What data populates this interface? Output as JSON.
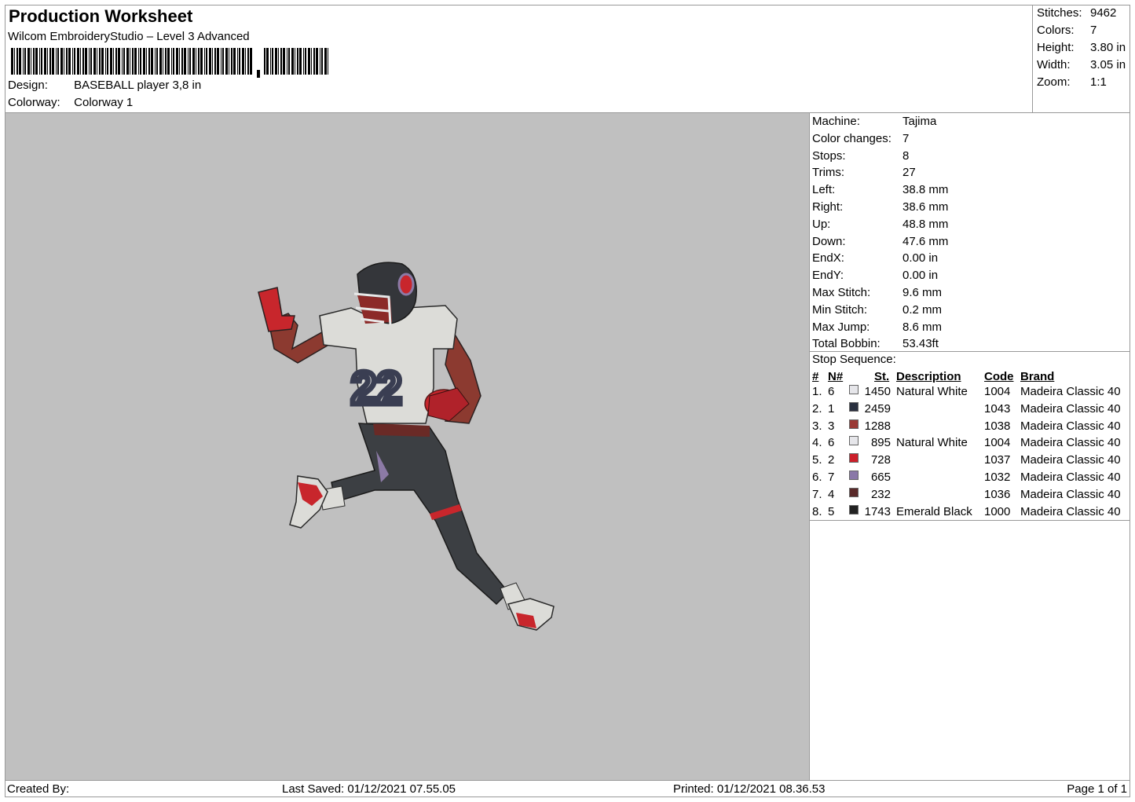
{
  "header": {
    "title": "Production Worksheet",
    "subtitle": "Wilcom EmbroideryStudio – Level 3 Advanced",
    "design_label": "Design:",
    "design_value": "BASEBALL player 3,8 in",
    "colorway_label": "Colorway:",
    "colorway_value": "Colorway 1"
  },
  "summary": [
    {
      "label": "Stitches:",
      "value": "9462"
    },
    {
      "label": "Colors:",
      "value": "7"
    },
    {
      "label": "Height:",
      "value": "3.80 in"
    },
    {
      "label": "Width:",
      "value": "3.05 in"
    },
    {
      "label": "Zoom:",
      "value": "1:1"
    }
  ],
  "machine": [
    {
      "label": "Machine:",
      "value": "Tajima"
    },
    {
      "label": "Color changes:",
      "value": "7"
    },
    {
      "label": "Stops:",
      "value": "8"
    },
    {
      "label": "Trims:",
      "value": "27"
    },
    {
      "label": "Left:",
      "value": "38.8 mm"
    },
    {
      "label": "Right:",
      "value": "38.6 mm"
    },
    {
      "label": "Up:",
      "value": "48.8 mm"
    },
    {
      "label": "Down:",
      "value": "47.6 mm"
    },
    {
      "label": "EndX:",
      "value": "0.00 in"
    },
    {
      "label": "EndY:",
      "value": "0.00 in"
    },
    {
      "label": "Max Stitch:",
      "value": "9.6 mm"
    },
    {
      "label": "Min Stitch:",
      "value": "0.2 mm"
    },
    {
      "label": "Max Jump:",
      "value": "8.6 mm"
    },
    {
      "label": "Total Bobbin:",
      "value": "53.43ft"
    }
  ],
  "stop_sequence": {
    "title": "Stop Sequence:",
    "headers": {
      "num": "#",
      "n": "N#",
      "st": "St.",
      "desc": "Description",
      "code": "Code",
      "brand": "Brand"
    },
    "rows": [
      {
        "num": "1.",
        "n": "6",
        "color": "#e6e6ea",
        "st": "1450",
        "desc": "Natural White",
        "code": "1004",
        "brand": "Madeira Classic 40"
      },
      {
        "num": "2.",
        "n": "1",
        "color": "#2a3040",
        "st": "2459",
        "desc": "",
        "code": "1043",
        "brand": "Madeira Classic 40"
      },
      {
        "num": "3.",
        "n": "3",
        "color": "#9a3a36",
        "st": "1288",
        "desc": "",
        "code": "1038",
        "brand": "Madeira Classic 40"
      },
      {
        "num": "4.",
        "n": "6",
        "color": "#e6e6ea",
        "st": "895",
        "desc": "Natural White",
        "code": "1004",
        "brand": "Madeira Classic 40"
      },
      {
        "num": "5.",
        "n": "2",
        "color": "#cc1f2a",
        "st": "728",
        "desc": "",
        "code": "1037",
        "brand": "Madeira Classic 40"
      },
      {
        "num": "6.",
        "n": "7",
        "color": "#8a78a8",
        "st": "665",
        "desc": "",
        "code": "1032",
        "brand": "Madeira Classic 40"
      },
      {
        "num": "7.",
        "n": "4",
        "color": "#5a2a2a",
        "st": "232",
        "desc": "",
        "code": "1036",
        "brand": "Madeira Classic 40"
      },
      {
        "num": "8.",
        "n": "5",
        "color": "#222222",
        "st": "1743",
        "desc": "Emerald Black",
        "code": "1000",
        "brand": "Madeira Classic 40"
      }
    ]
  },
  "footer": {
    "created_by": "Created By:",
    "last_saved": "Last Saved: 01/12/2021 07.55.05",
    "printed": "Printed: 01/12/2021 08.36.53",
    "page": "Page 1 of 1"
  },
  "colors": {
    "preview_bg": "#c0c0c0",
    "jersey": "#dcdcd8",
    "pants": "#3c3f43",
    "skin": "#8c3a30",
    "accent_red": "#c8262c",
    "number": "#3a3e52",
    "purple": "#8c7aa6"
  }
}
